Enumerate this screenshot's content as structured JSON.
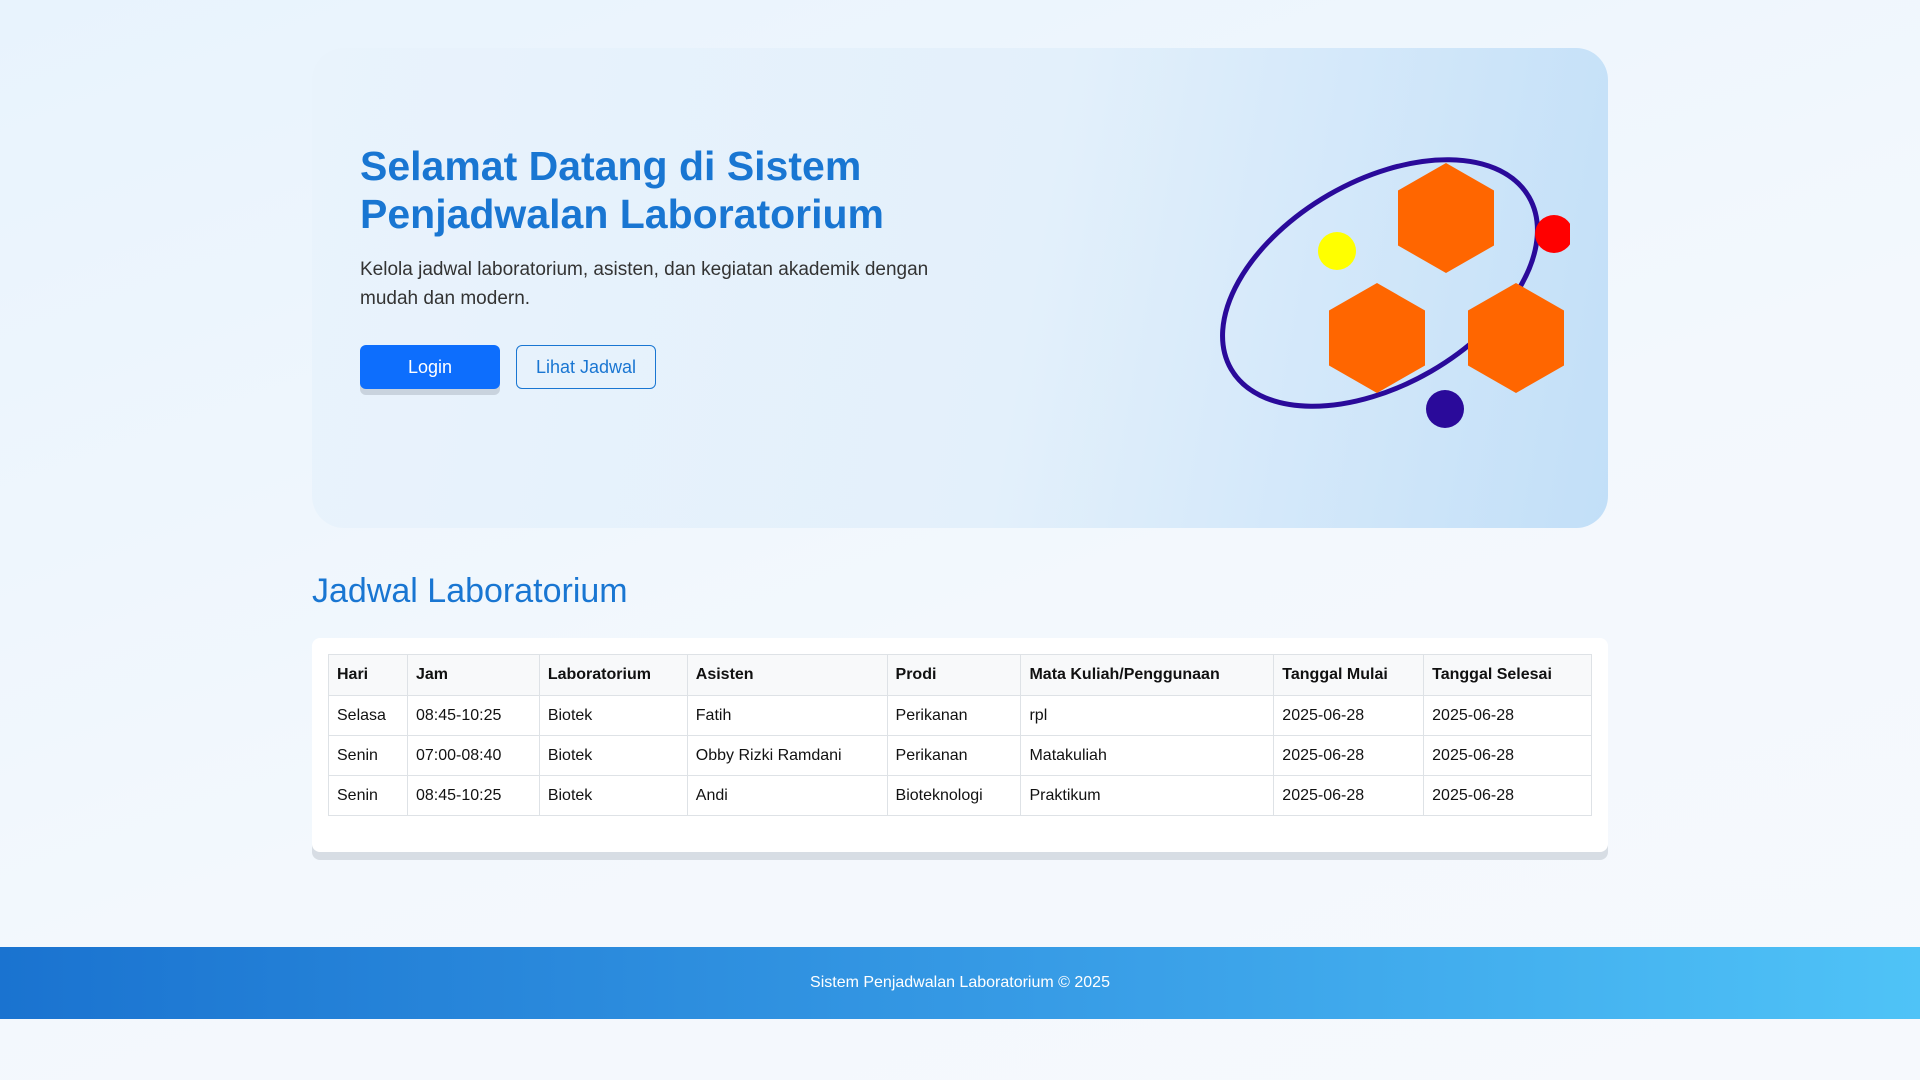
{
  "hero": {
    "title": "Selamat Datang di Sistem Penjadwalan Laboratorium",
    "subtitle": "Kelola jadwal laboratorium, asisten, dan kegiatan akademik dengan mudah dan modern.",
    "login_label": "Login",
    "schedule_label": "Lihat Jadwal",
    "logo": {
      "hexagon_color": "#ff6600",
      "orbit_color": "#2a0a9a",
      "dot_colors": [
        "#ffff00",
        "#ff0000",
        "#2a0a9a"
      ]
    }
  },
  "schedule": {
    "title": "Jadwal Laboratorium",
    "columns": [
      "Hari",
      "Jam",
      "Laboratorium",
      "Asisten",
      "Prodi",
      "Mata Kuliah/Penggunaan",
      "Tanggal Mulai",
      "Tanggal Selesai"
    ],
    "rows": [
      [
        "Selasa",
        "08:45-10:25",
        "Biotek",
        "Fatih",
        "Perikanan",
        "rpl",
        "2025-06-28",
        "2025-06-28"
      ],
      [
        "Senin",
        "07:00-08:40",
        "Biotek",
        "Obby Rizki Ramdani",
        "Perikanan",
        "Matakuliah",
        "2025-06-28",
        "2025-06-28"
      ],
      [
        "Senin",
        "08:45-10:25",
        "Biotek",
        "Andi",
        "Bioteknologi",
        "Praktikum",
        "2025-06-28",
        "2025-06-28"
      ]
    ]
  },
  "footer": {
    "text": "Sistem Penjadwalan Laboratorium © 2025"
  }
}
